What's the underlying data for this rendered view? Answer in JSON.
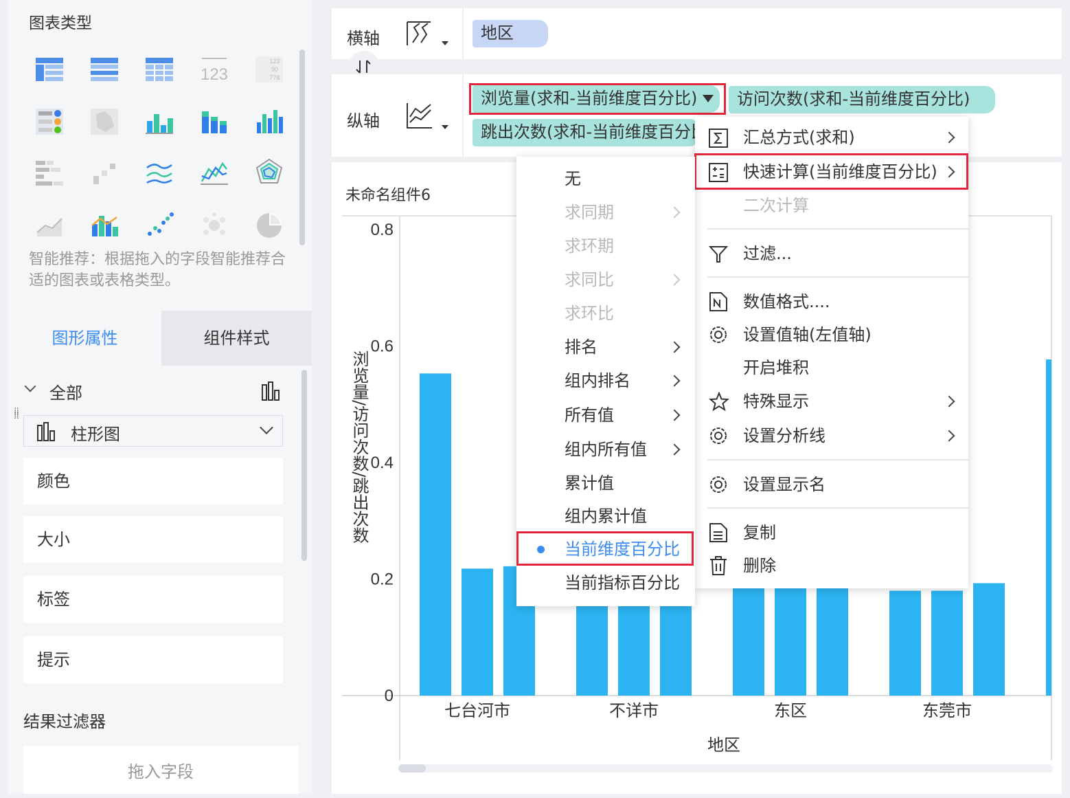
{
  "left_panel": {
    "chart_types_title": "图表类型",
    "hint": "智能推荐：根据拖入的字段智能推荐合适的图表或表格类型。",
    "tabs": [
      "图形属性",
      "组件样式"
    ],
    "all_label": "全部",
    "chart_select": "柱形图",
    "properties": [
      "颜色",
      "大小",
      "标签",
      "提示"
    ],
    "result_filter_title": "结果过滤器",
    "drop_field": "拖入字段"
  },
  "axes": {
    "x_label": "横轴",
    "x_field": "地区",
    "y_label": "纵轴",
    "y_fields": [
      "浏览量(求和-当前维度百分比)",
      "访问次数(求和-当前维度百分比)",
      "跳出次数(求和-当前维度百分比)"
    ]
  },
  "chart_card": {
    "title": "未命名组件6"
  },
  "chart_data": {
    "type": "bar",
    "categories": [
      "七台河市",
      "不详市",
      "东区",
      "东莞市"
    ],
    "series": [
      {
        "name": "浏览量(求和-当前维度百分比)",
        "values": [
          0.553,
          0.18,
          0.2,
          0.18
        ]
      },
      {
        "name": "访问次数(求和-当前维度百分比)",
        "values": [
          0.218,
          0.18,
          0.2,
          0.18
        ]
      },
      {
        "name": "跳出次数(求和-当前维度百分比)",
        "values": [
          0.222,
          0.18,
          0.2,
          0.193
        ]
      }
    ],
    "partial_bar_value": 0.577,
    "ylabel": "浏览量/访问次数/跳出次数",
    "xlabel": "地区",
    "ylim": [
      0,
      0.8
    ],
    "y_ticks": [
      "0",
      "0.2",
      "0.4",
      "0.6",
      "0.8"
    ],
    "grid": false,
    "bar_color": "#2cb4f2"
  },
  "context_menu": {
    "items": [
      {
        "label": "汇总方式(求和)",
        "icon": "sigma-icon",
        "submenu": true
      },
      {
        "label": "快速计算(当前维度百分比)",
        "icon": "calculator-icon",
        "submenu": true
      },
      {
        "label": "二次计算",
        "disabled": true
      },
      {
        "label": "过滤...",
        "icon": "filter-icon"
      },
      {
        "label": "数值格式....",
        "icon": "number-format-icon"
      },
      {
        "label": "设置值轴(左值轴)",
        "icon": "gear-icon"
      },
      {
        "label": "开启堆积"
      },
      {
        "label": "特殊显示",
        "icon": "star-icon",
        "submenu": true
      },
      {
        "label": "设置分析线",
        "icon": "gear-icon",
        "submenu": true
      },
      {
        "label": "设置显示名",
        "icon": "gear-icon"
      },
      {
        "label": "复制",
        "icon": "copy-icon"
      },
      {
        "label": "删除",
        "icon": "trash-icon"
      }
    ]
  },
  "quick_calc_menu": {
    "items": [
      {
        "label": "无"
      },
      {
        "label": "求同期",
        "disabled": true,
        "submenu": true
      },
      {
        "label": "求环期",
        "disabled": true
      },
      {
        "label": "求同比",
        "disabled": true,
        "submenu": true
      },
      {
        "label": "求环比",
        "disabled": true
      },
      {
        "label": "排名",
        "submenu": true
      },
      {
        "label": "组内排名",
        "submenu": true
      },
      {
        "label": "所有值",
        "submenu": true
      },
      {
        "label": "组内所有值",
        "submenu": true
      },
      {
        "label": "累计值"
      },
      {
        "label": "组内累计值"
      },
      {
        "label": "当前维度百分比",
        "selected": true
      },
      {
        "label": "当前指标百分比"
      }
    ]
  },
  "colors": {
    "accent": "#3b8cf0",
    "highlight_border": "#e0263a",
    "pill_blue": "#c7d6f4",
    "pill_teal": "#a8e4dd"
  }
}
